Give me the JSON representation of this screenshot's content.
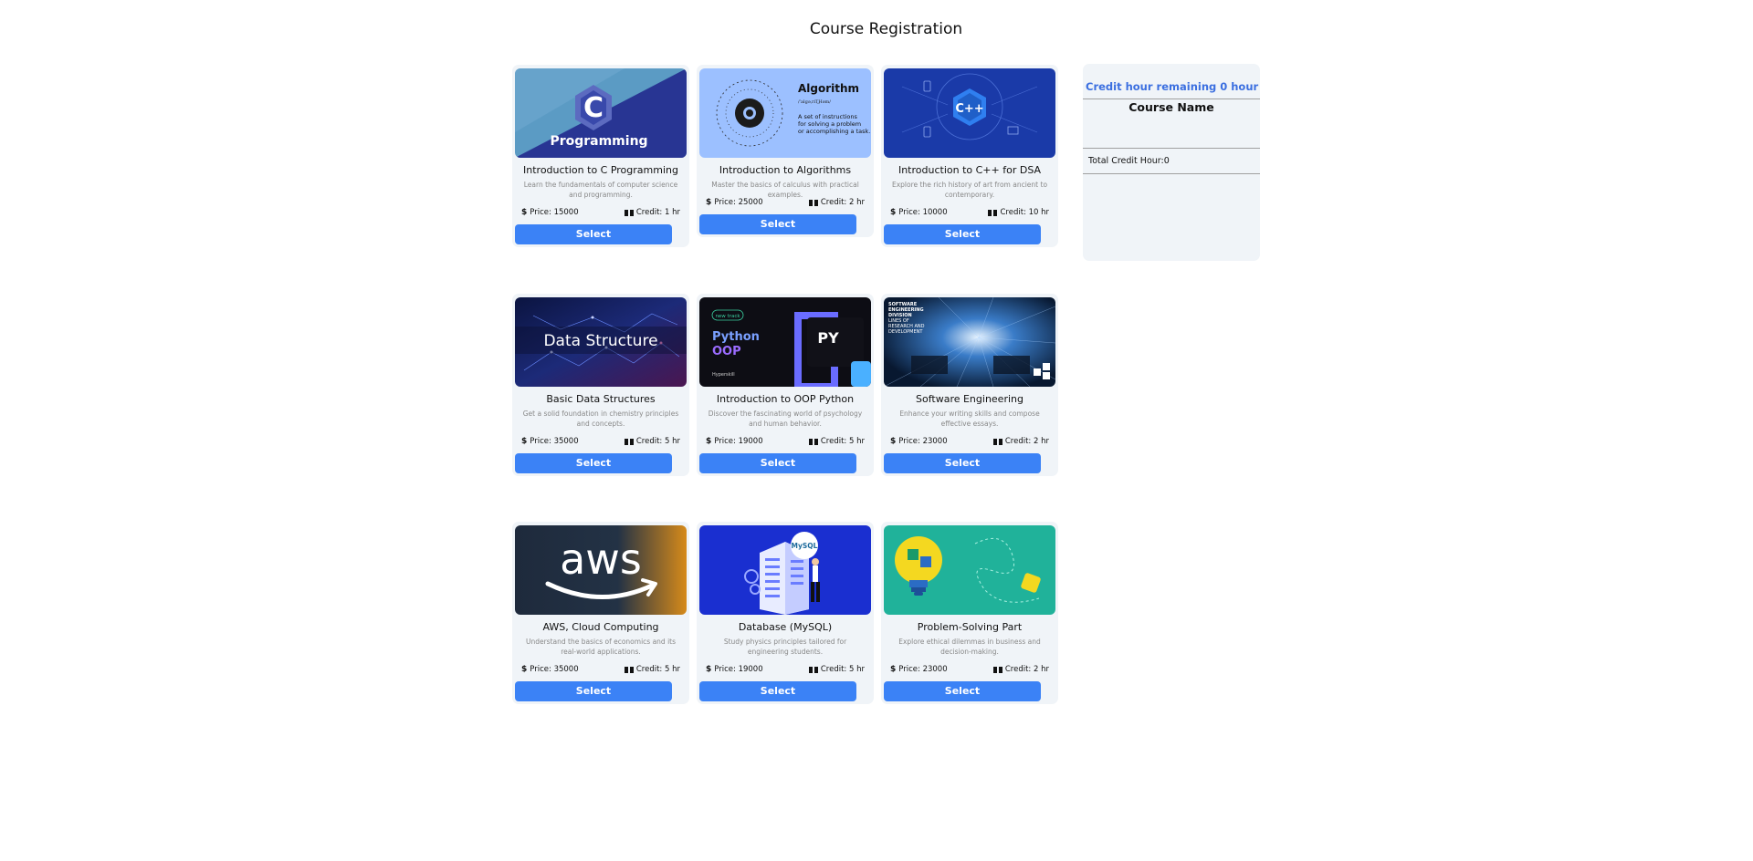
{
  "page": {
    "title": "Course Registration"
  },
  "labels": {
    "select": "Select",
    "price_prefix": "Price: ",
    "credit_prefix": "Credit: ",
    "dollar": "$"
  },
  "courses": [
    {
      "title": "Introduction to C Programming",
      "desc": "Learn the fundamentals of computer science and programming.",
      "price": "Price: 15000",
      "credit": "Credit: 1 hr",
      "image": "c-programming"
    },
    {
      "title": "Introduction to Algorithms",
      "desc": "Master the basics of calculus with practical examples.",
      "price": "Price: 25000",
      "credit": "Credit: 2 hr",
      "image": "algorithm"
    },
    {
      "title": "Introduction to C++ for DSA",
      "desc": "Explore the rich history of art from ancient to contemporary.",
      "price": "Price: 10000",
      "credit": "Credit: 10 hr",
      "image": "cpp"
    },
    {
      "title": "Basic Data Structures",
      "desc": "Get a solid foundation in chemistry principles and concepts.",
      "price": "Price: 35000",
      "credit": "Credit: 5 hr",
      "image": "data-structure"
    },
    {
      "title": "Introduction to OOP Python",
      "desc": "Discover the fascinating world of psychology and human behavior.",
      "price": "Price: 19000",
      "credit": "Credit: 5 hr",
      "image": "python-oop"
    },
    {
      "title": "Software Engineering",
      "desc": "Enhance your writing skills and compose effective essays.",
      "price": "Price: 23000",
      "credit": "Credit: 2 hr",
      "image": "software-engineering"
    },
    {
      "title": "AWS, Cloud Computing",
      "desc": "Understand the basics of economics and its real-world applications.",
      "price": "Price: 35000",
      "credit": "Credit: 5 hr",
      "image": "aws"
    },
    {
      "title": "Database (MySQL)",
      "desc": "Study physics principles tailored for engineering students.",
      "price": "Price: 19000",
      "credit": "Credit: 5 hr",
      "image": "mysql"
    },
    {
      "title": "Problem-Solving Part",
      "desc": "Explore ethical dilemmas in business and decision-making.",
      "price": "Price: 23000",
      "credit": "Credit: 2 hr",
      "image": "problem-solving"
    }
  ],
  "images_text": {
    "c_logo": "C",
    "c_caption": "Programming",
    "algo_title": "Algorithm",
    "algo_phonetic": "/ˈalɡəˌriT͟Həm/",
    "algo_line1": "A set of instructions",
    "algo_line2": "for solving a problem",
    "algo_line3": "or accomplishing a task.",
    "cpp_logo": "C++",
    "ds_caption": "Data Structure",
    "py_badge": "new track",
    "py_line1": "Python",
    "py_line2": "OOP",
    "py_logo": "PY",
    "py_brand": "Hyperskill",
    "se_line1": "SOFTWARE",
    "se_line2": "ENGINEERING",
    "se_line3": "DIVISION",
    "se_line4": "LINES OF",
    "se_line5": "RESEARCH AND",
    "se_line6": "DEVELOPMENT",
    "aws_logo": "aws",
    "mysql_logo": "MySQL"
  },
  "cart": {
    "remaining": "Credit hour remaining 0 hour",
    "heading": "Course Name",
    "total": "Total Credit Hour:0"
  },
  "colors": {
    "accent": "#3b82f6",
    "card_bg": "#f0f4f8",
    "remaining_text": "#3b6fe0"
  }
}
